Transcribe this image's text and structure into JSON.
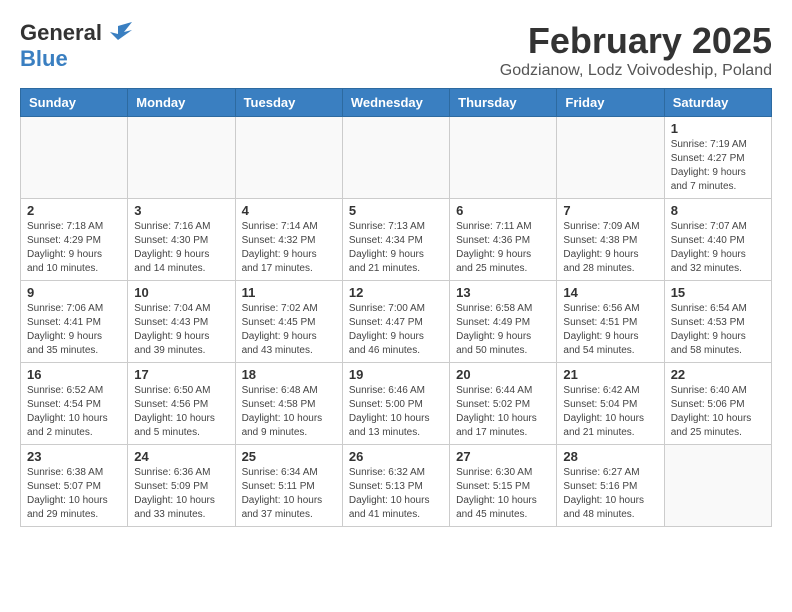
{
  "header": {
    "logo_general": "General",
    "logo_blue": "Blue",
    "month_title": "February 2025",
    "location": "Godzianow, Lodz Voivodeship, Poland"
  },
  "days_of_week": [
    "Sunday",
    "Monday",
    "Tuesday",
    "Wednesday",
    "Thursday",
    "Friday",
    "Saturday"
  ],
  "weeks": [
    [
      {
        "day": "",
        "info": ""
      },
      {
        "day": "",
        "info": ""
      },
      {
        "day": "",
        "info": ""
      },
      {
        "day": "",
        "info": ""
      },
      {
        "day": "",
        "info": ""
      },
      {
        "day": "",
        "info": ""
      },
      {
        "day": "1",
        "info": "Sunrise: 7:19 AM\nSunset: 4:27 PM\nDaylight: 9 hours and 7 minutes."
      }
    ],
    [
      {
        "day": "2",
        "info": "Sunrise: 7:18 AM\nSunset: 4:29 PM\nDaylight: 9 hours and 10 minutes."
      },
      {
        "day": "3",
        "info": "Sunrise: 7:16 AM\nSunset: 4:30 PM\nDaylight: 9 hours and 14 minutes."
      },
      {
        "day": "4",
        "info": "Sunrise: 7:14 AM\nSunset: 4:32 PM\nDaylight: 9 hours and 17 minutes."
      },
      {
        "day": "5",
        "info": "Sunrise: 7:13 AM\nSunset: 4:34 PM\nDaylight: 9 hours and 21 minutes."
      },
      {
        "day": "6",
        "info": "Sunrise: 7:11 AM\nSunset: 4:36 PM\nDaylight: 9 hours and 25 minutes."
      },
      {
        "day": "7",
        "info": "Sunrise: 7:09 AM\nSunset: 4:38 PM\nDaylight: 9 hours and 28 minutes."
      },
      {
        "day": "8",
        "info": "Sunrise: 7:07 AM\nSunset: 4:40 PM\nDaylight: 9 hours and 32 minutes."
      }
    ],
    [
      {
        "day": "9",
        "info": "Sunrise: 7:06 AM\nSunset: 4:41 PM\nDaylight: 9 hours and 35 minutes."
      },
      {
        "day": "10",
        "info": "Sunrise: 7:04 AM\nSunset: 4:43 PM\nDaylight: 9 hours and 39 minutes."
      },
      {
        "day": "11",
        "info": "Sunrise: 7:02 AM\nSunset: 4:45 PM\nDaylight: 9 hours and 43 minutes."
      },
      {
        "day": "12",
        "info": "Sunrise: 7:00 AM\nSunset: 4:47 PM\nDaylight: 9 hours and 46 minutes."
      },
      {
        "day": "13",
        "info": "Sunrise: 6:58 AM\nSunset: 4:49 PM\nDaylight: 9 hours and 50 minutes."
      },
      {
        "day": "14",
        "info": "Sunrise: 6:56 AM\nSunset: 4:51 PM\nDaylight: 9 hours and 54 minutes."
      },
      {
        "day": "15",
        "info": "Sunrise: 6:54 AM\nSunset: 4:53 PM\nDaylight: 9 hours and 58 minutes."
      }
    ],
    [
      {
        "day": "16",
        "info": "Sunrise: 6:52 AM\nSunset: 4:54 PM\nDaylight: 10 hours and 2 minutes."
      },
      {
        "day": "17",
        "info": "Sunrise: 6:50 AM\nSunset: 4:56 PM\nDaylight: 10 hours and 5 minutes."
      },
      {
        "day": "18",
        "info": "Sunrise: 6:48 AM\nSunset: 4:58 PM\nDaylight: 10 hours and 9 minutes."
      },
      {
        "day": "19",
        "info": "Sunrise: 6:46 AM\nSunset: 5:00 PM\nDaylight: 10 hours and 13 minutes."
      },
      {
        "day": "20",
        "info": "Sunrise: 6:44 AM\nSunset: 5:02 PM\nDaylight: 10 hours and 17 minutes."
      },
      {
        "day": "21",
        "info": "Sunrise: 6:42 AM\nSunset: 5:04 PM\nDaylight: 10 hours and 21 minutes."
      },
      {
        "day": "22",
        "info": "Sunrise: 6:40 AM\nSunset: 5:06 PM\nDaylight: 10 hours and 25 minutes."
      }
    ],
    [
      {
        "day": "23",
        "info": "Sunrise: 6:38 AM\nSunset: 5:07 PM\nDaylight: 10 hours and 29 minutes."
      },
      {
        "day": "24",
        "info": "Sunrise: 6:36 AM\nSunset: 5:09 PM\nDaylight: 10 hours and 33 minutes."
      },
      {
        "day": "25",
        "info": "Sunrise: 6:34 AM\nSunset: 5:11 PM\nDaylight: 10 hours and 37 minutes."
      },
      {
        "day": "26",
        "info": "Sunrise: 6:32 AM\nSunset: 5:13 PM\nDaylight: 10 hours and 41 minutes."
      },
      {
        "day": "27",
        "info": "Sunrise: 6:30 AM\nSunset: 5:15 PM\nDaylight: 10 hours and 45 minutes."
      },
      {
        "day": "28",
        "info": "Sunrise: 6:27 AM\nSunset: 5:16 PM\nDaylight: 10 hours and 48 minutes."
      },
      {
        "day": "",
        "info": ""
      }
    ]
  ]
}
